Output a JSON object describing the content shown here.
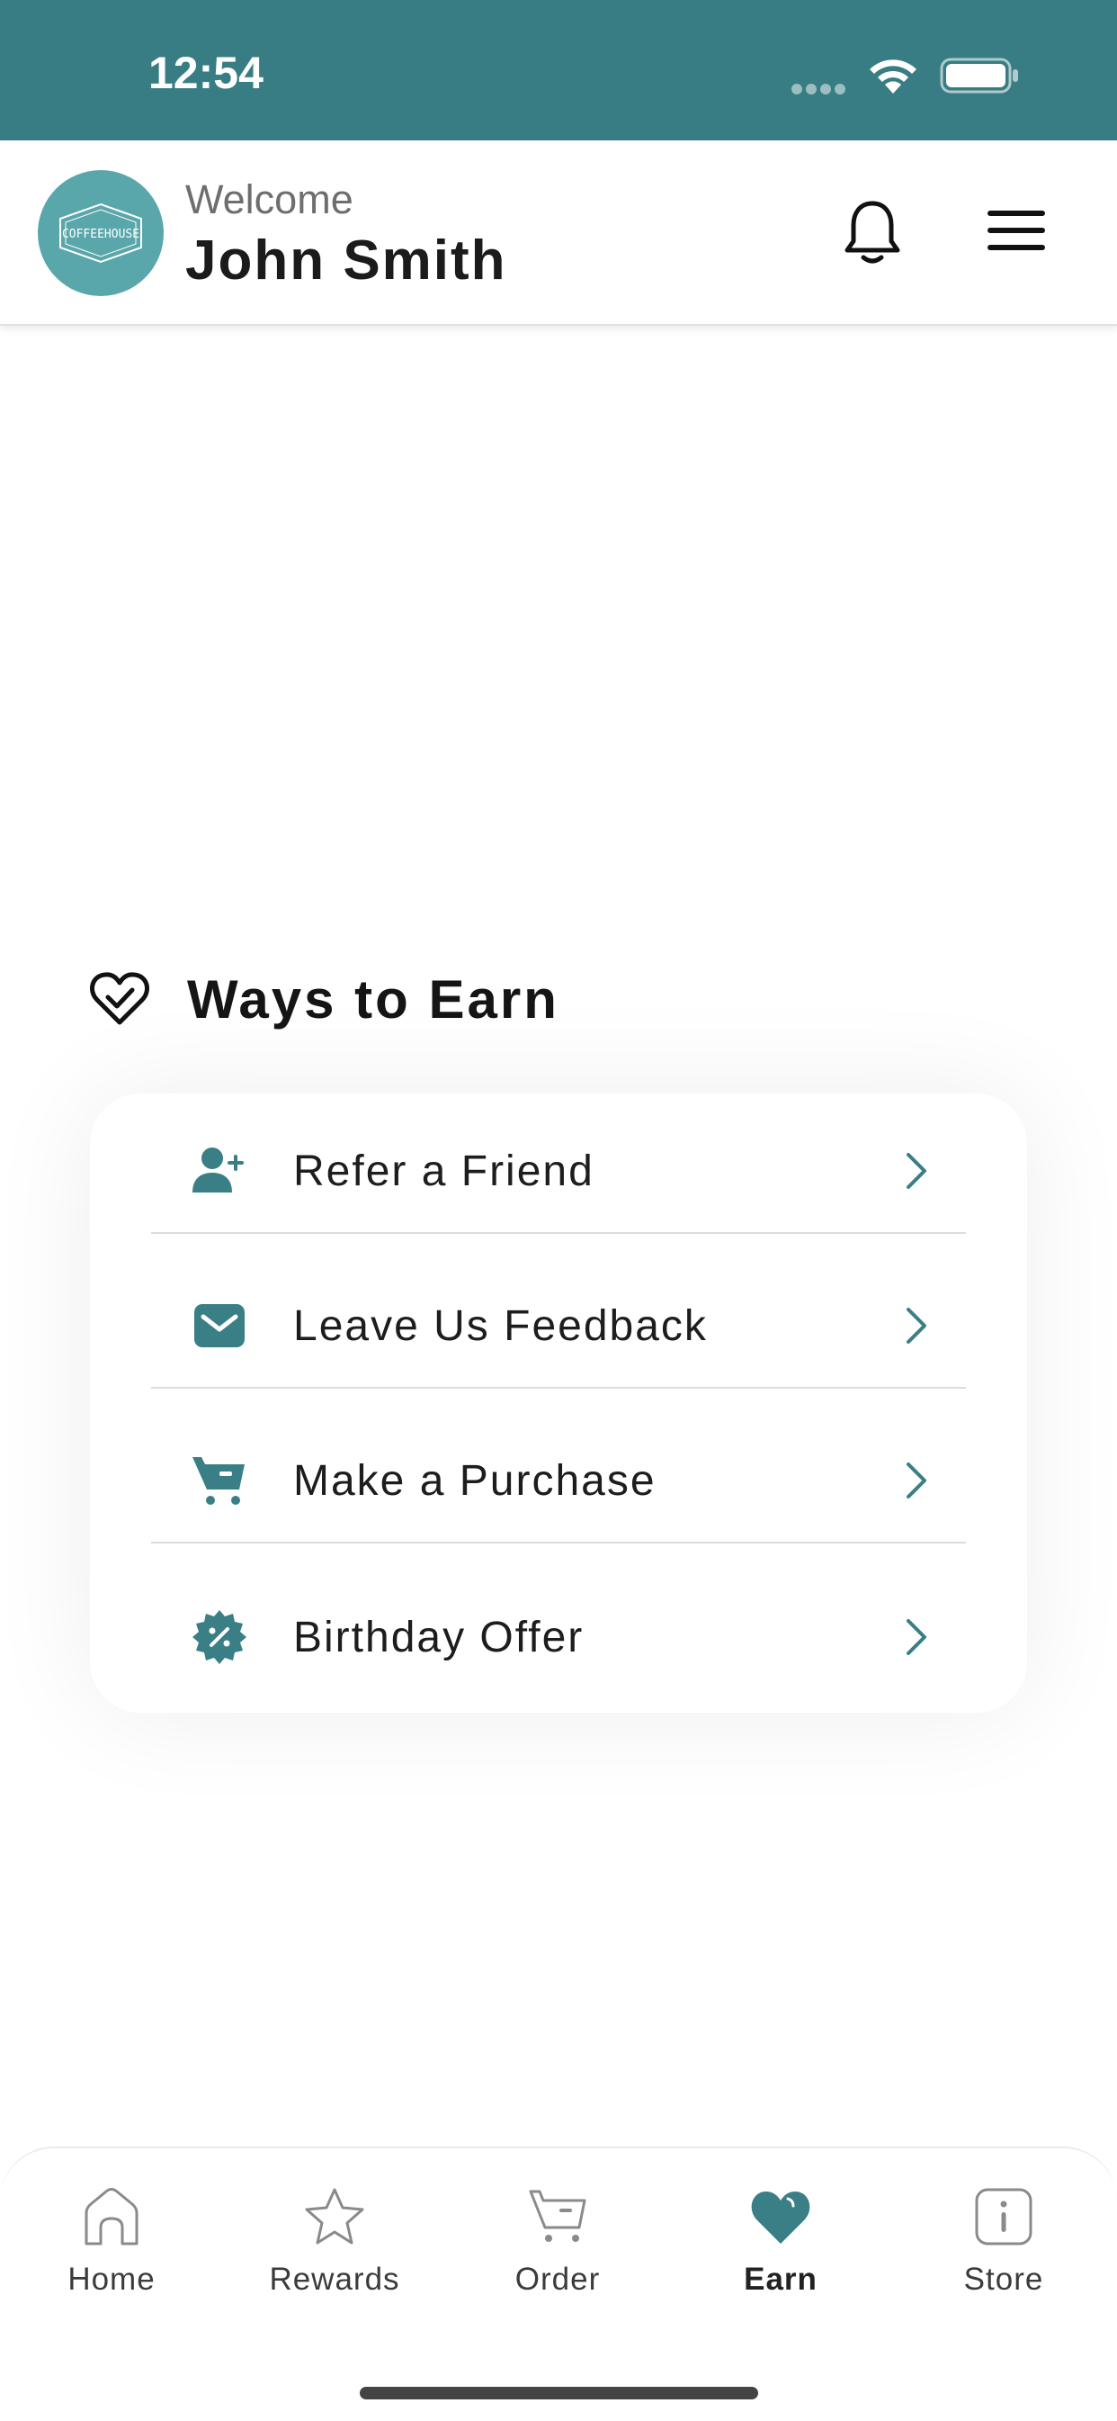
{
  "status_bar": {
    "time": "12:54"
  },
  "header": {
    "welcome_text": "Welcome",
    "user_name": "John Smith",
    "logo_text": "COFFEEHOUSE"
  },
  "earn_section": {
    "title": "Ways to Earn",
    "items": [
      {
        "label": "Refer a Friend",
        "icon": "add-user-icon"
      },
      {
        "label": "Leave Us Feedback",
        "icon": "envelope-icon"
      },
      {
        "label": "Make a Purchase",
        "icon": "cart-icon"
      },
      {
        "label": "Birthday Offer",
        "icon": "discount-badge-icon"
      }
    ]
  },
  "tab_bar": {
    "tabs": [
      {
        "label": "Home",
        "icon": "home-icon",
        "active": false
      },
      {
        "label": "Rewards",
        "icon": "star-icon",
        "active": false
      },
      {
        "label": "Order",
        "icon": "cart-icon",
        "active": false
      },
      {
        "label": "Earn",
        "icon": "heart-icon",
        "active": true
      },
      {
        "label": "Store",
        "icon": "info-icon",
        "active": false
      }
    ]
  },
  "colors": {
    "brand": "#377d83",
    "accent": "#3a7f85",
    "text_dark": "#1b1b1b",
    "text_muted": "#6e6e6e"
  }
}
